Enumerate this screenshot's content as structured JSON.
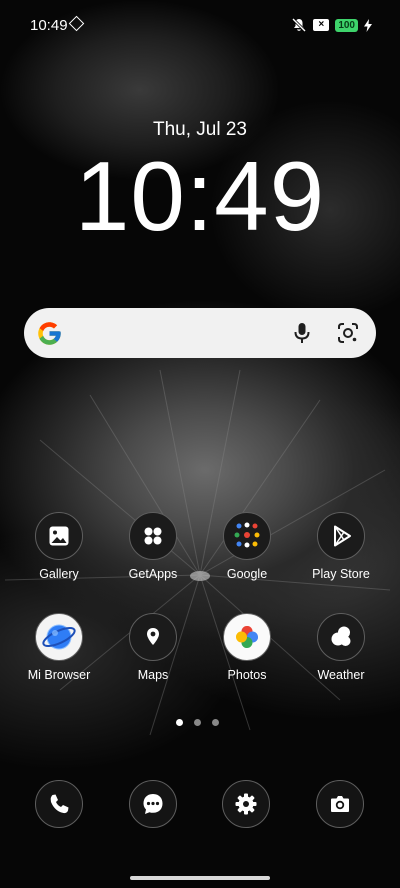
{
  "status_bar": {
    "time": "10:49",
    "sim_label": "×",
    "battery": "100",
    "icons": [
      "diamond-icon",
      "mute-icon",
      "no-sim-icon",
      "battery-icon",
      "charging-bolt-icon"
    ]
  },
  "lock_clock": {
    "date": "Thu, Jul 23",
    "time": "10:49"
  },
  "search": {
    "icons": [
      "google-g-icon",
      "microphone-icon",
      "lens-icon"
    ]
  },
  "apps": [
    {
      "label": "Gallery",
      "icon": "gallery-icon"
    },
    {
      "label": "GetApps",
      "icon": "getapps-icon"
    },
    {
      "label": "Google",
      "icon": "google-folder-icon"
    },
    {
      "label": "Play Store",
      "icon": "play-store-icon"
    },
    {
      "label": "Mi Browser",
      "icon": "browser-icon"
    },
    {
      "label": "Maps",
      "icon": "maps-icon"
    },
    {
      "label": "Photos",
      "icon": "photos-icon"
    },
    {
      "label": "Weather",
      "icon": "weather-icon"
    }
  ],
  "page_indicator": {
    "pages": 3,
    "current": 1
  },
  "dock": [
    "phone-icon",
    "messages-icon",
    "settings-icon",
    "camera-icon"
  ],
  "colors": {
    "battery_green": "#3ed36b",
    "search_bg": "#f1f1f1",
    "icon_bg": "#1b1b1b"
  }
}
